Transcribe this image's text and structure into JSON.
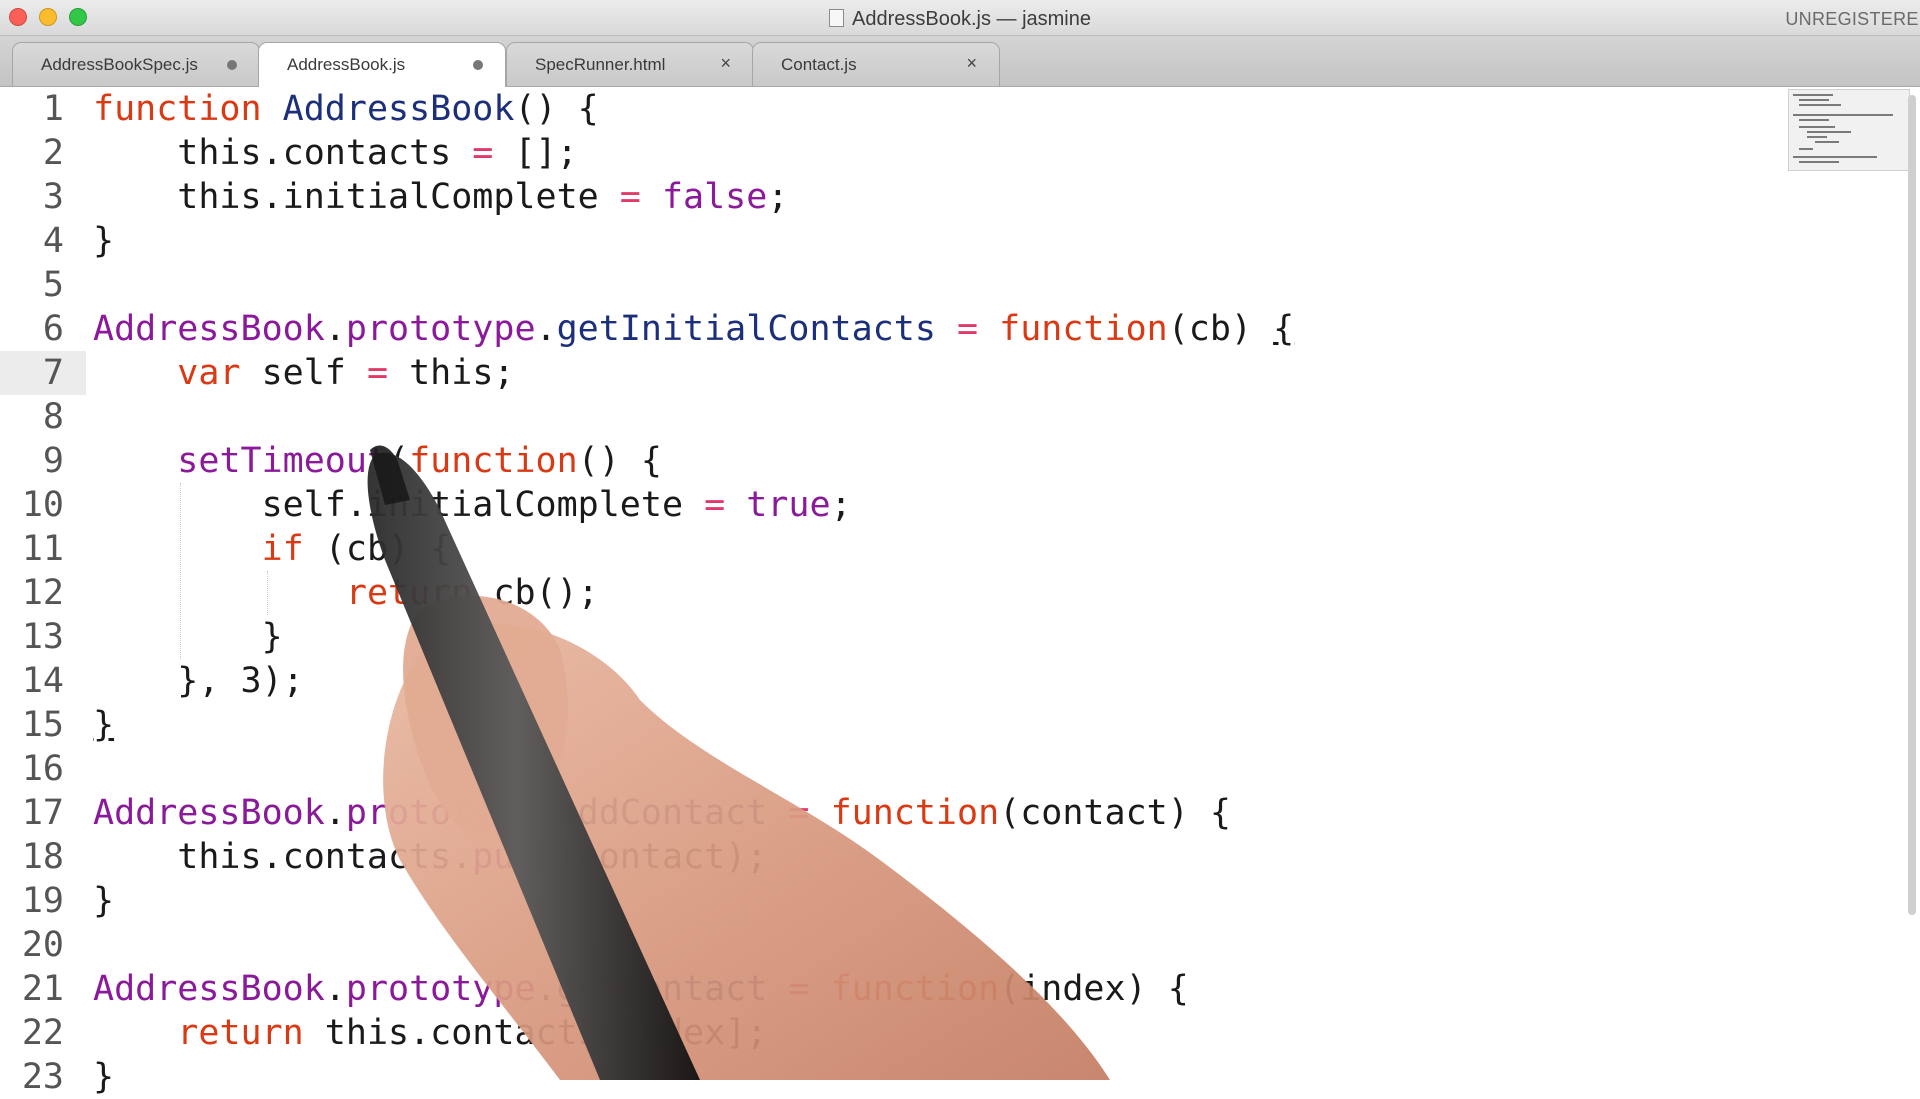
{
  "window": {
    "title": "AddressBook.js — jasmine",
    "unregistered": "UNREGISTERED"
  },
  "tabs": [
    {
      "label": "AddressBookSpec.js",
      "state": "modified"
    },
    {
      "label": "AddressBook.js",
      "state": "modified",
      "active": true
    },
    {
      "label": "SpecRunner.html",
      "state": "close"
    },
    {
      "label": "Contact.js",
      "state": "close"
    }
  ],
  "tab_close_glyph": "×",
  "editor": {
    "current_line": 7,
    "line_numbers": [
      "1",
      "2",
      "3",
      "4",
      "5",
      "6",
      "7",
      "8",
      "9",
      "10",
      "11",
      "12",
      "13",
      "14",
      "15",
      "16",
      "17",
      "18",
      "19",
      "20",
      "21",
      "22",
      "23"
    ],
    "code": {
      "l1": {
        "kw": "function",
        "sp": " ",
        "name": "AddressBook",
        "rest": "() {"
      },
      "l2": {
        "a": "    this.contacts ",
        "op": "=",
        "b": " [];"
      },
      "l3": {
        "a": "    this.initialComplete ",
        "op": "=",
        "sp": " ",
        "bool": "false",
        "b": ";"
      },
      "l4": {
        "a": "}"
      },
      "l6": {
        "cls": "AddressBook",
        "dot1": ".",
        "proto": "prototype",
        "dot2": ".",
        "method": "getInitialContacts",
        "sp1": " ",
        "op": "=",
        "sp2": " ",
        "kw": "function",
        "args": "(cb) ",
        "brace": "{"
      },
      "l7": {
        "indent": "    ",
        "kw": "var",
        "a": " self ",
        "op": "=",
        "b": " this;"
      },
      "l9": {
        "indent": "    ",
        "fn": "setTimeout",
        "p": "(",
        "kw": "function",
        "b": "() {"
      },
      "l10": {
        "a": "        self.initialComplete ",
        "op": "=",
        "sp": " ",
        "bool": "true",
        "b": ";"
      },
      "l11": {
        "indent": "        ",
        "kw": "if",
        "b": " (cb) {"
      },
      "l12": {
        "indent": "            ",
        "kw": "return",
        "b": " cb();"
      },
      "l13": {
        "a": "        }"
      },
      "l14": {
        "a": "    }, 3);"
      },
      "l15": {
        "a": "}"
      },
      "l17": {
        "cls": "AddressBook",
        "dot1": ".",
        "proto": "prototype",
        "dot2": ".",
        "method": "addContact",
        "sp1": " ",
        "op": "=",
        "sp2": " ",
        "kw": "function",
        "args": "(contact) {"
      },
      "l18": {
        "a": "    this.contacts.",
        "fn": "push",
        "b": "(contact);"
      },
      "l19": {
        "a": "}"
      },
      "l21": {
        "cls": "AddressBook",
        "dot1": ".",
        "proto": "prototype",
        "dot2": ".",
        "method": "getContact",
        "sp1": " ",
        "op": "=",
        "sp2": " ",
        "kw": "function",
        "args": "(index) {"
      },
      "l22": {
        "indent": "    ",
        "kw": "return",
        "b": " this.contacts[index];"
      },
      "l23": {
        "a": "}"
      }
    }
  },
  "colors": {
    "keyword": "#d93a14",
    "function_name": "#1c2f7a",
    "class_name": "#8a1a9a",
    "operator": "#e13a6a",
    "boolean": "#8a1a9a"
  }
}
